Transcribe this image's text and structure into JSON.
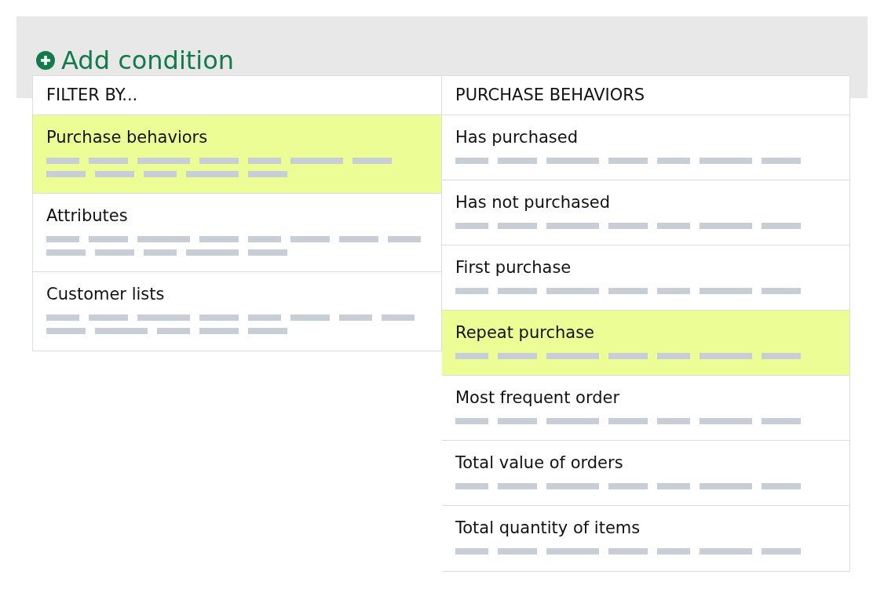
{
  "add_condition": {
    "label": "Add condition"
  },
  "filter_menu": {
    "header": "FILTER BY...",
    "items": [
      {
        "label": "Purchase behaviors",
        "selected": true
      },
      {
        "label": "Attributes",
        "selected": false
      },
      {
        "label": "Customer lists",
        "selected": false
      }
    ]
  },
  "submenu": {
    "header": "PURCHASE BEHAVIORS",
    "items": [
      {
        "label": "Has purchased",
        "selected": false
      },
      {
        "label": "Has not purchased",
        "selected": false
      },
      {
        "label": "First purchase",
        "selected": false
      },
      {
        "label": "Repeat purchase",
        "selected": true
      },
      {
        "label": "Most frequent order",
        "selected": false
      },
      {
        "label": "Total value of orders",
        "selected": false
      },
      {
        "label": "Total quantity of items",
        "selected": false
      }
    ]
  }
}
